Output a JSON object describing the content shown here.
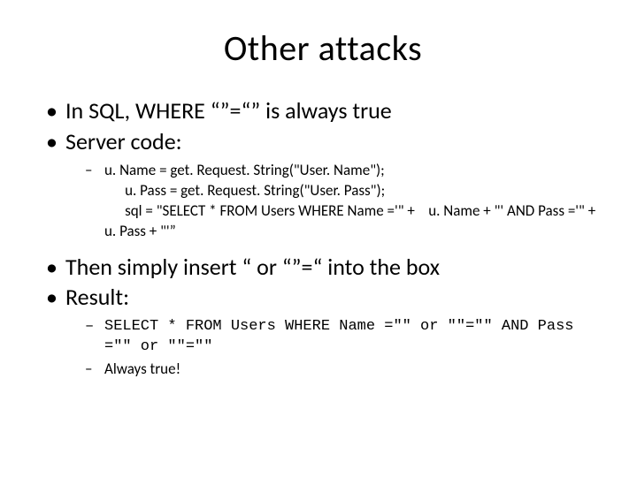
{
  "title": "Other attacks",
  "bullets": {
    "b1": "In SQL, WHERE “”=“” is always true",
    "b2": "Server code:",
    "b2_code": "u. Name = get. Request. String(\"User. Name\");\n      u. Pass = get. Request. String(\"User. Pass\");\n      sql = \"SELECT * FROM Users WHERE Name ='\" +    u. Name + \"' AND Pass ='\" + u. Pass + \"'”",
    "b3": "Then simply insert “ or “”=“ into the box",
    "b4": "Result:",
    "b4_code": "SELECT * FROM Users WHERE Name =\"\" or \"\"=\"\" AND Pass =\"\" or \"\"=\"\"",
    "b4_always": "Always true!"
  }
}
